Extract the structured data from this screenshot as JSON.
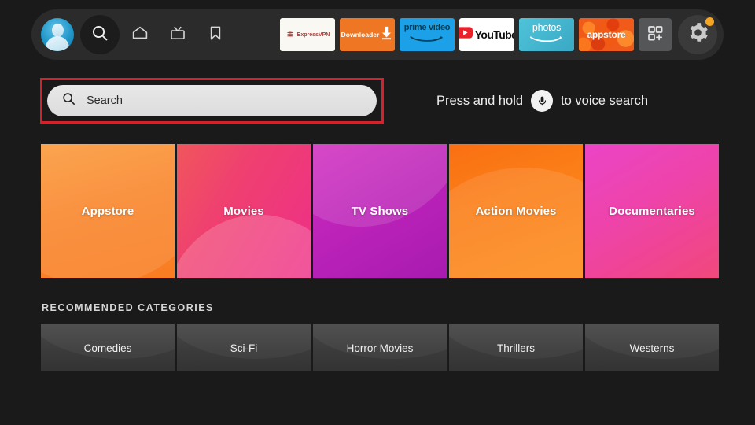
{
  "topbar": {
    "avatar": {
      "name": "profile-avatar",
      "label": "Profile"
    },
    "nav_items": [
      {
        "icon": "search-icon",
        "label": "Search",
        "active": true
      },
      {
        "icon": "home-icon",
        "label": "Home",
        "active": false
      },
      {
        "icon": "tv-icon",
        "label": "Live TV",
        "active": false
      },
      {
        "icon": "bookmark-icon",
        "label": "Watchlist",
        "active": false
      }
    ],
    "apps": [
      {
        "name": "expressvpn",
        "label": "ExpressVPN",
        "bg": "#faf8f3"
      },
      {
        "name": "downloader",
        "label": "Downloader",
        "bg": "#ef7622"
      },
      {
        "name": "prime-video",
        "label": "prime video",
        "bg": "#1ca0e8"
      },
      {
        "name": "youtube",
        "label": "YouTube",
        "bg": "#ffffff"
      },
      {
        "name": "photos",
        "label": "photos",
        "bg": "#4fc3d9"
      },
      {
        "name": "appstore",
        "label": "appstore",
        "bg": "#f05a1a"
      }
    ],
    "apps_grid_label": "Apps",
    "settings_label": "Settings",
    "settings_has_notification": true,
    "notification_color": "#f5a623"
  },
  "search": {
    "placeholder": "Search",
    "highlight_color": "#d0232b",
    "voice_hint_before": "Press and hold",
    "voice_hint_after": "to voice search"
  },
  "features": [
    {
      "label": "Appstore",
      "class": "f-appstore",
      "accent": "#f9862c"
    },
    {
      "label": "Movies",
      "class": "f-movies",
      "accent": "#ee2f87"
    },
    {
      "label": "TV Shows",
      "class": "f-tvshows",
      "accent": "#bb22b8"
    },
    {
      "label": "Action Movies",
      "class": "f-action",
      "accent": "#fb7f18"
    },
    {
      "label": "Documentaries",
      "class": "f-docs",
      "accent": "#ec2c9f"
    }
  ],
  "recommended": {
    "header": "RECOMMENDED CATEGORIES",
    "items": [
      {
        "label": "Comedies"
      },
      {
        "label": "Sci-Fi"
      },
      {
        "label": "Horror Movies"
      },
      {
        "label": "Thrillers"
      },
      {
        "label": "Westerns"
      }
    ]
  }
}
